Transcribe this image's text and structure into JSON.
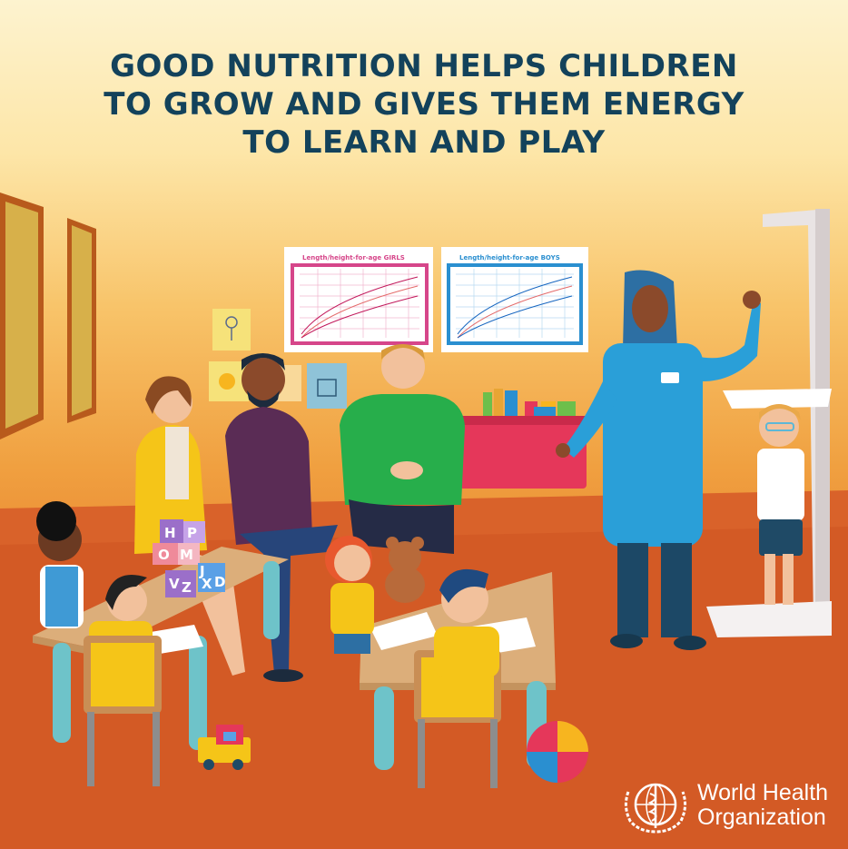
{
  "headline": {
    "line1": "GOOD NUTRITION HELPS CHILDREN",
    "line2": "TO GROW AND GIVES THEM ENERGY",
    "line3": "TO LEARN AND PLAY"
  },
  "wall_charts": {
    "girls": {
      "title": "Length/height-for-age GIRLS",
      "color": "#d6468a"
    },
    "boys": {
      "title": "Length/height-for-age BOYS",
      "color": "#2a8fd0"
    }
  },
  "blocks": {
    "top": [
      "H",
      "P"
    ],
    "middle": [
      "O",
      "M"
    ],
    "bottom": [
      "V",
      "Z",
      "J",
      "X",
      "D"
    ]
  },
  "logo": {
    "name_line1": "World Health",
    "name_line2": "Organization",
    "emblem": "who-emblem-icon"
  },
  "colors": {
    "headline": "#13425b",
    "wall_top": "#fdf3cf",
    "floor": "#cc4f1e",
    "table": "#dcae7a",
    "table_legs": "#6ec3c9",
    "nurse_uniform": "#2a9fd8"
  }
}
